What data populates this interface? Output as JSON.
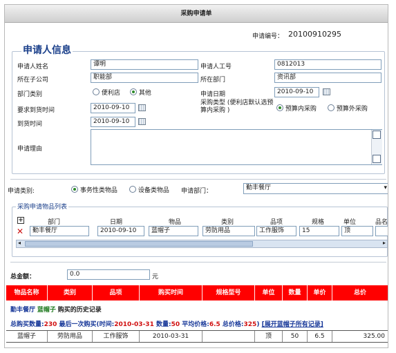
{
  "form": {
    "title": "采购申请单",
    "req_no_label": "申请编号：",
    "req_no": "20100910295"
  },
  "applicant": {
    "section_title": "申请人信息",
    "name_label": "申请人姓名",
    "name_value": "谭明",
    "empid_label": "申请人工号",
    "empid_value": "0812013",
    "subco_label": "所在子公司",
    "subco_value": "职能部",
    "dept_label": "所在部门",
    "dept_value": "资讯部",
    "depttype_label": "部门类别",
    "depttype_opt1": "便利店",
    "depttype_opt2": "其他",
    "date_label": "申请日期",
    "date_value": "2010-09-10",
    "arrive_req_label": "要求到货时间",
    "arrive_req_value": "2010-09-10",
    "purtype_label": "采购类型 (便利店默认选预算内采购 )",
    "purtype_opt1": "预算内采购",
    "purtype_opt2": "预算外采购",
    "arrive_label": "到货时间",
    "arrive_value": "2010-09-10",
    "reason_label": "申请理由"
  },
  "purchase": {
    "category_label": "申请类别:",
    "category_opt1": "事务性类物品",
    "category_opt2": "设备类物品",
    "dept_label": "申请部门：",
    "dept_value": "勤丰餐厅",
    "list_title": "采购申请物品列表",
    "columns": [
      "部门",
      "日期",
      "物品",
      "类别",
      "品项",
      "规格",
      "单位",
      "品名"
    ],
    "row": {
      "dept": "勤丰餐厅",
      "date": "2010-09-10",
      "item": "蓝帽子",
      "category": "劳防用品",
      "subitem": "工作服饰",
      "spec": "15",
      "unit": "顶"
    },
    "expand_icon": "plus-box-icon",
    "delete_icon": "red-x-icon"
  },
  "total": {
    "label": "总金额：",
    "value": "0.0",
    "unit": "元"
  },
  "history": {
    "columns": [
      "物品名称",
      "类别",
      "品项",
      "购买时间",
      "规格型号",
      "单位",
      "数量",
      "单价",
      "总价"
    ],
    "dept": "勤丰餐厅",
    "item": "蓝帽子",
    "title_suffix": "购买的历史记录",
    "summary": {
      "total_qty_label": "总购买数量:",
      "total_qty": "230",
      "last_label": " 最后一次购买(时间:",
      "last_time": "2010-03-31",
      "qty_label": " 数量:",
      "qty": "50",
      "avg_label": " 平均价格:",
      "avg": "6.5",
      "total_label": " 总价格:",
      "total": "325",
      "close": ")",
      "expand_link": "[展开蓝帽子所有记录]"
    },
    "row": {
      "name": "蓝帽子",
      "category": "劳防用品",
      "subitem": "工作服饰",
      "time": "2010-03-31",
      "spec": "",
      "unit": "顶",
      "qty": "50",
      "price": "6.5",
      "total": "325.00"
    }
  }
}
